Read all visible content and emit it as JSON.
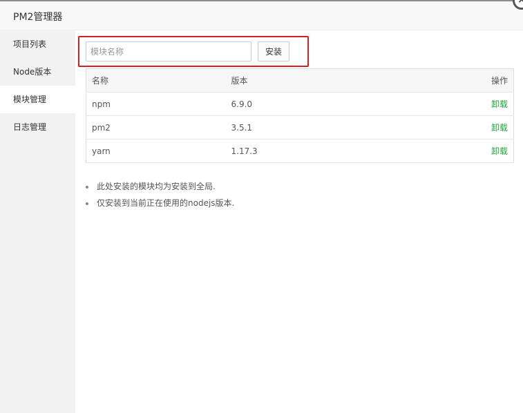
{
  "window": {
    "title": "PM2管理器",
    "close_glyph": "×"
  },
  "sidebar": {
    "items": [
      {
        "label": "项目列表",
        "active": false
      },
      {
        "label": "Node版本",
        "active": false
      },
      {
        "label": "模块管理",
        "active": true
      },
      {
        "label": "日志管理",
        "active": false
      }
    ]
  },
  "install": {
    "placeholder": "模块名称",
    "value": "",
    "button_label": "安装"
  },
  "table": {
    "headers": {
      "name": "名称",
      "version": "版本",
      "operation": "操作"
    },
    "rows": [
      {
        "name": "npm",
        "version": "6.9.0",
        "action": "卸载"
      },
      {
        "name": "pm2",
        "version": "3.5.1",
        "action": "卸载"
      },
      {
        "name": "yarn",
        "version": "1.17.3",
        "action": "卸载"
      }
    ]
  },
  "notes": [
    "此处安装的模块均为安装到全局.",
    "仅安装到当前正在使用的nodejs版本."
  ],
  "colors": {
    "accent_green": "#20a53a",
    "highlight_red": "#d81e1e"
  }
}
